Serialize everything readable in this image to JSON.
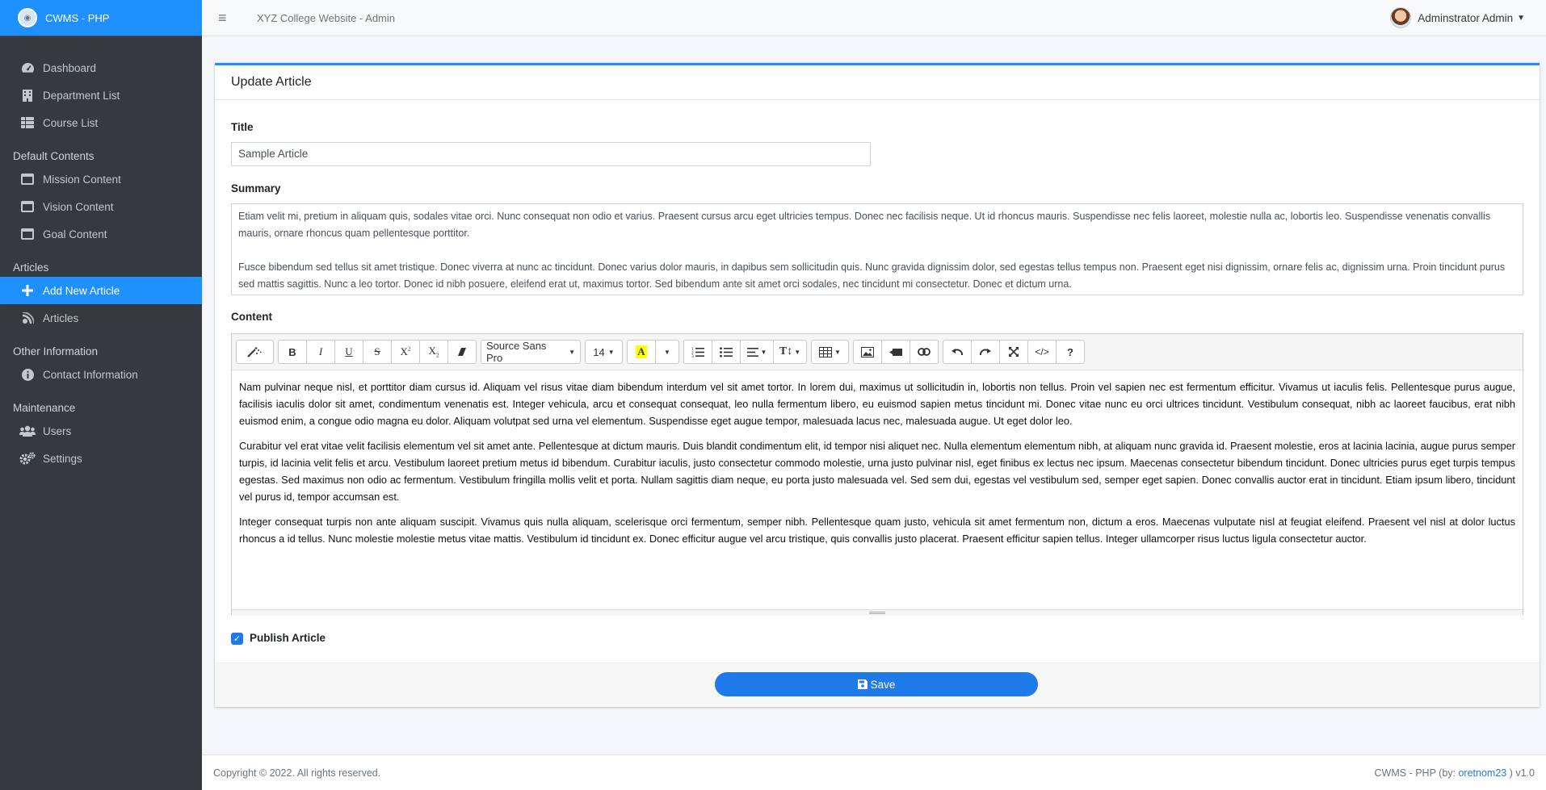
{
  "brand": {
    "title": "CWMS - PHP"
  },
  "sidebar": {
    "items": [
      {
        "label": "Dashboard",
        "icon": "tachometer-icon"
      },
      {
        "label": "Department List",
        "icon": "building-icon"
      },
      {
        "label": "Course List",
        "icon": "table-icon"
      }
    ],
    "section_default": "Default Contents",
    "default_items": [
      {
        "label": "Mission Content",
        "icon": "window-icon"
      },
      {
        "label": "Vision Content",
        "icon": "window-icon"
      },
      {
        "label": "Goal Content",
        "icon": "window-icon"
      }
    ],
    "section_articles": "Articles",
    "article_items": [
      {
        "label": "Add New Article",
        "icon": "plus-icon",
        "active": true
      },
      {
        "label": "Articles",
        "icon": "blog-icon"
      }
    ],
    "section_other": "Other Information",
    "other_items": [
      {
        "label": "Contact Information",
        "icon": "info-icon"
      }
    ],
    "section_maintenance": "Maintenance",
    "maintenance_items": [
      {
        "label": "Users",
        "icon": "users-icon"
      },
      {
        "label": "Settings",
        "icon": "gears-icon"
      }
    ]
  },
  "topbar": {
    "site_title": "XYZ College Website - Admin",
    "user_name": "Adminstrator Admin"
  },
  "card": {
    "title": "Update Article",
    "title_label": "Title",
    "title_value": "Sample Article",
    "summary_label": "Summary",
    "summary_p1": "Etiam velit mi, pretium in aliquam quis, sodales vitae orci. Nunc consequat non odio et varius. Praesent cursus arcu eget ultricies tempus. Donec nec facilisis neque. Ut id rhoncus mauris. Suspendisse nec felis laoreet, molestie nulla ac, lobortis leo. Suspendisse venenatis convallis mauris, ornare rhoncus quam pellentesque porttitor.",
    "summary_p2": "Fusce bibendum sed tellus sit amet tristique. Donec viverra at nunc ac tincidunt. Donec varius dolor mauris, in dapibus sem sollicitudin quis. Nunc gravida dignissim dolor, sed egestas tellus tempus non. Praesent eget nisi dignissim, ornare felis ac, dignissim urna. Proin tincidunt purus sed mattis sagittis. Nunc a leo tortor. Donec id nibh posuere, eleifend erat ut, maximus tortor. Sed bibendum ante sit amet orci sodales, nec tincidunt mi consectetur. Donec et dictum urna.",
    "content_label": "Content",
    "toolbar": {
      "font_name": "Source Sans Pro",
      "font_size": "14"
    },
    "content_p1": "Nam pulvinar neque nisl, et porttitor diam cursus id. Aliquam vel risus vitae diam bibendum interdum vel sit amet tortor. In lorem dui, maximus ut sollicitudin in, lobortis non tellus. Proin vel sapien nec est fermentum efficitur. Vivamus ut iaculis felis. Pellentesque purus augue, facilisis iaculis dolor sit amet, condimentum venenatis est. Integer vehicula, arcu et consequat consequat, leo nulla fermentum libero, eu euismod sapien metus tincidunt mi. Donec vitae nunc eu orci ultrices tincidunt. Vestibulum consequat, nibh ac laoreet faucibus, erat nibh euismod enim, a congue odio magna eu dolor. Aliquam volutpat sed urna vel elementum. Suspendisse eget augue tempor, malesuada lacus nec, malesuada augue. Ut eget dolor leo.",
    "content_p2": "Curabitur vel erat vitae velit facilisis elementum vel sit amet ante. Pellentesque at dictum mauris. Duis blandit condimentum elit, id tempor nisi aliquet nec. Nulla elementum elementum nibh, at aliquam nunc gravida id. Praesent molestie, eros at lacinia lacinia, augue purus semper turpis, id lacinia velit felis et arcu. Vestibulum laoreet pretium metus id bibendum. Curabitur iaculis, justo consectetur commodo molestie, urna justo pulvinar nisl, eget finibus ex lectus nec ipsum. Maecenas consectetur bibendum tincidunt. Donec ultricies purus eget turpis tempus egestas. Sed maximus non odio ac fermentum. Vestibulum fringilla mollis velit et porta. Nullam sagittis diam neque, eu porta justo malesuada vel. Sed sem dui, egestas vel vestibulum sed, semper eget sapien. Donec convallis auctor erat in tincidunt. Etiam ipsum libero, tincidunt vel purus id, tempor accumsan est.",
    "content_p3": "Integer consequat turpis non ante aliquam suscipit. Vivamus quis nulla aliquam, scelerisque orci fermentum, semper nibh. Pellentesque quam justo, vehicula sit amet fermentum non, dictum a eros. Maecenas vulputate nisl at feugiat eleifend. Praesent vel nisl at dolor luctus rhoncus a id tellus. Nunc molestie molestie metus vitae mattis. Vestibulum id tincidunt ex. Donec efficitur augue vel arcu tristique, quis convallis justo placerat. Praesent efficitur sapien tellus. Integer ullamcorper risus luctus ligula consectetur auctor.",
    "publish_label": "Publish Article",
    "publish_checked": true,
    "save_label": "Save"
  },
  "footer": {
    "copyright": "Copyright © 2022. All rights reserved.",
    "credit_prefix": "CWMS - PHP (by: ",
    "credit_link": "oretnom23",
    "credit_suffix": " ) v1.0"
  },
  "colors": {
    "accent": "#1e90ff",
    "sidebar_bg": "#343a40",
    "button": "#1e7ae8"
  }
}
